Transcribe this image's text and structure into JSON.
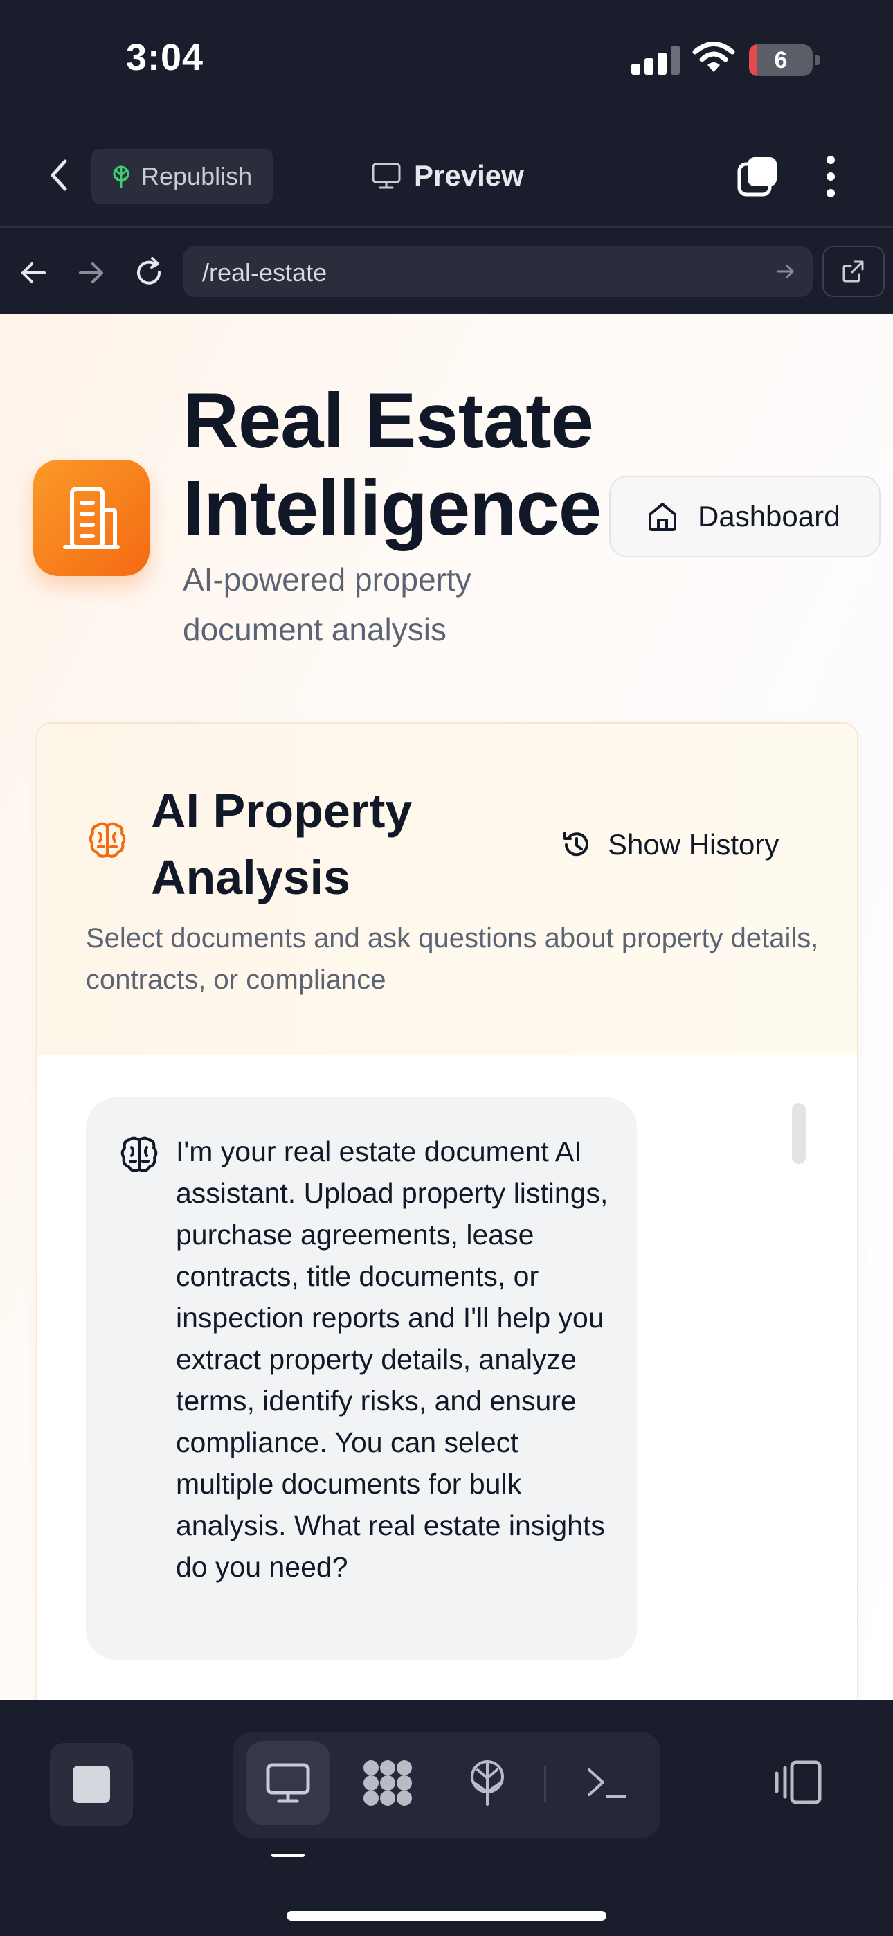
{
  "status_bar": {
    "time": "3:04",
    "battery_level": "6",
    "battery_color": "#e5484d"
  },
  "toolbar": {
    "back_icon": "chevron-left-icon",
    "republish_label": "Republish",
    "republish_icon": "globe-tree-icon",
    "preview_label": "Preview",
    "preview_icon": "monitor-icon",
    "tabs_icon": "tabs-icon",
    "menu_icon": "kebab-icon"
  },
  "browser": {
    "url": "/real-estate",
    "back_icon": "arrow-left-icon",
    "forward_icon": "arrow-right-icon",
    "reload_icon": "reload-icon",
    "external_icon": "external-link-icon"
  },
  "hero": {
    "title": "Real Estate Intelligence",
    "subtitle": "AI-powered property document analysis",
    "logo_icon": "building-icon",
    "accent_color": "#f46a12",
    "dashboard_label": "Dashboard",
    "dashboard_icon": "home-icon"
  },
  "analysis_card": {
    "icon": "brain-icon",
    "title": "AI Property Analysis",
    "history_label": "Show History",
    "history_icon": "history-icon",
    "description": "Select documents and ask questions about property details, contracts, or compliance",
    "assistant_message": "I'm your real estate document AI assistant. Upload property listings, purchase agreements, lease contracts, title documents, or inspection reports and I'll help you extract property details, analyze terms, identify risks, and ensure compliance. You can select multiple documents for bulk analysis. What real estate insights do you need?"
  },
  "dock": {
    "stop_icon": "stop-icon",
    "items": [
      {
        "name": "preview",
        "icon": "monitor-icon",
        "active": true
      },
      {
        "name": "apps",
        "icon": "grid-blob-icon",
        "active": false
      },
      {
        "name": "deploy",
        "icon": "globe-tree-icon",
        "active": false
      },
      {
        "name": "shell",
        "icon": "terminal-icon",
        "active": false
      }
    ],
    "panel_icon": "panel-toggle-icon"
  }
}
